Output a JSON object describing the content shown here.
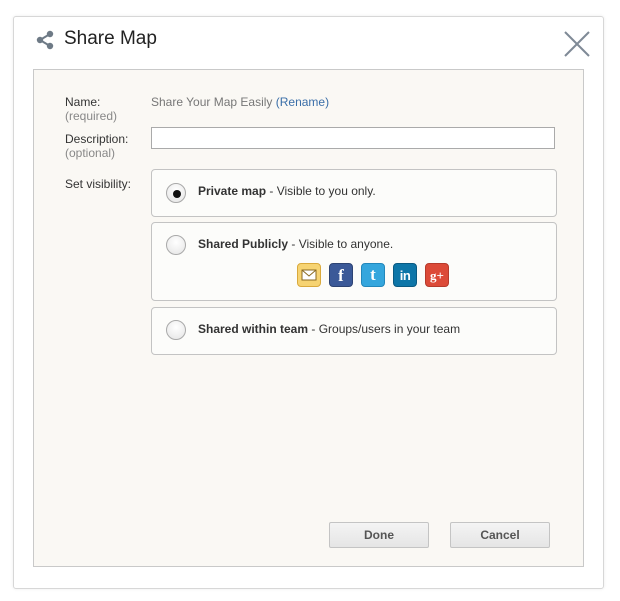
{
  "dialog": {
    "title": "Share Map",
    "header_icon": "share-icon",
    "close_icon": "close-icon"
  },
  "form": {
    "name_label": "Name:",
    "name_hint": "(required)",
    "name_value": "Share Your Map Easily",
    "rename_link": "(Rename)",
    "description_label": "Description:",
    "description_hint": "(optional)",
    "description_value": "",
    "visibility_label": "Set visibility:"
  },
  "visibility_options": [
    {
      "title": "Private map",
      "description": " - Visible to you only.",
      "selected": true
    },
    {
      "title": "Shared Publicly",
      "description": " - Visible to anyone.",
      "selected": false
    },
    {
      "title": "Shared within team",
      "description": " - Groups/users in your team",
      "selected": false
    }
  ],
  "social_icons": [
    {
      "name": "email-icon",
      "glyph": ""
    },
    {
      "name": "facebook-icon",
      "glyph": "f"
    },
    {
      "name": "twitter-icon",
      "glyph": "t"
    },
    {
      "name": "linkedin-icon",
      "glyph": "in"
    },
    {
      "name": "google-plus-icon",
      "glyph": "g+"
    }
  ],
  "buttons": {
    "done": "Done",
    "cancel": "Cancel"
  },
  "colors": {
    "panel_background": "#faf8f4",
    "link": "#3a6ea8",
    "facebook": "#3b5998",
    "twitter": "#35a6dd",
    "linkedin": "#0e76a8",
    "google_plus": "#dc4a38",
    "email": "#f6d372"
  }
}
